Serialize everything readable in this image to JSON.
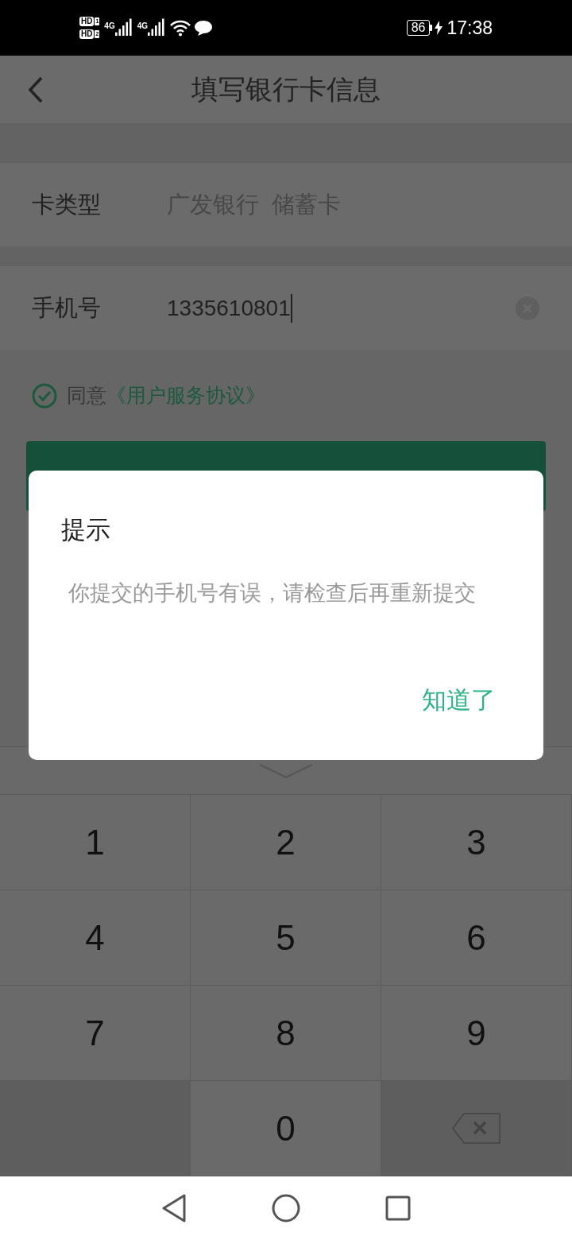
{
  "status_bar": {
    "sims": [
      {
        "label": "HD",
        "slot": "1"
      },
      {
        "label": "HD",
        "slot": "2"
      }
    ],
    "networks": [
      "4G",
      "4G"
    ],
    "battery": "86",
    "charging": true,
    "time": "17:38"
  },
  "header": {
    "title": "填写银行卡信息"
  },
  "form": {
    "card_type": {
      "label": "卡类型",
      "value": "广发银行  储蓄卡"
    },
    "phone": {
      "label": "手机号",
      "value": "1335610801",
      "focused": true
    }
  },
  "agreement": {
    "checked": true,
    "prefix": "同意",
    "link": "《用户服务协议》"
  },
  "dialog": {
    "title": "提示",
    "message": "你提交的手机号有误，请检查后再重新提交",
    "button": "知道了"
  },
  "keypad": [
    {
      "kind": "digit",
      "label": "1"
    },
    {
      "kind": "digit",
      "label": "2"
    },
    {
      "kind": "digit",
      "label": "3"
    },
    {
      "kind": "digit",
      "label": "4"
    },
    {
      "kind": "digit",
      "label": "5"
    },
    {
      "kind": "digit",
      "label": "6"
    },
    {
      "kind": "digit",
      "label": "7"
    },
    {
      "kind": "digit",
      "label": "8"
    },
    {
      "kind": "digit",
      "label": "9"
    },
    {
      "kind": "blank"
    },
    {
      "kind": "digit",
      "label": "0"
    },
    {
      "kind": "backspace"
    }
  ]
}
